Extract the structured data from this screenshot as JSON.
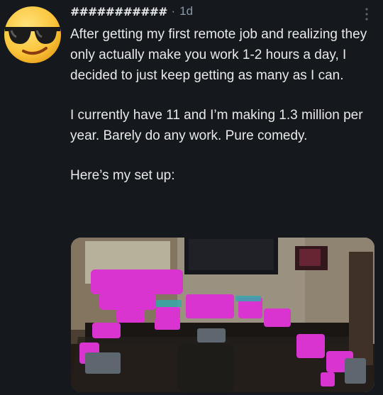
{
  "author": {
    "username": "###########",
    "separator": "·",
    "timestamp": "1d",
    "avatar_icon": "sunglasses-emoji-icon"
  },
  "post": {
    "paragraphs": [
      "After getting my first remote job and realizing they only actually make you work 1-2 hours a day, I decided to just keep getting as many as I can.",
      "I currently have 11 and I’m making 1.3 million per year. Barely do any work. Pure comedy.",
      "Here’s my set up:"
    ]
  },
  "menu": {
    "icon": "more-vertical-icon"
  },
  "media": {
    "subject": "desk-setup-photo",
    "redaction_color": "#ff3df5"
  },
  "colors": {
    "background": "#15181c",
    "text": "#e7e9ea",
    "muted": "#8b98a5"
  }
}
